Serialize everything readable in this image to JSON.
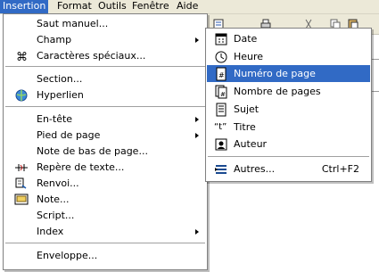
{
  "menubar": {
    "items": [
      {
        "label": "Insertion",
        "active": true
      },
      {
        "label": "Format"
      },
      {
        "label": "Outils"
      },
      {
        "label": "Fenêtre"
      },
      {
        "label": "Aide"
      }
    ]
  },
  "insert_menu": {
    "items": [
      {
        "label": "Saut manuel...",
        "submenu": false
      },
      {
        "label": "Champ",
        "submenu": true
      },
      {
        "label": "Caractères spéciaux...",
        "icon": "omega-symbol-icon"
      },
      {
        "label": "Section..."
      },
      {
        "label": "Hyperlien",
        "icon": "hyperlink-globe-icon"
      },
      {
        "label": "En-tête",
        "submenu": true
      },
      {
        "label": "Pied de page",
        "submenu": true
      },
      {
        "label": "Note de bas de page..."
      },
      {
        "label": "Repère de texte...",
        "icon": "bookmark-icon"
      },
      {
        "label": "Renvoi...",
        "icon": "cross-reference-icon"
      },
      {
        "label": "Note...",
        "icon": "note-icon"
      },
      {
        "label": "Script..."
      },
      {
        "label": "Index",
        "submenu": true
      },
      {
        "label": "Enveloppe..."
      }
    ]
  },
  "field_submenu": {
    "items": [
      {
        "label": "Date",
        "icon": "calendar-icon"
      },
      {
        "label": "Heure",
        "icon": "clock-icon"
      },
      {
        "label": "Numéro de page",
        "icon": "page-number-icon",
        "highlighted": true
      },
      {
        "label": "Nombre de pages",
        "icon": "page-count-icon"
      },
      {
        "label": "Sujet",
        "icon": "subject-icon"
      },
      {
        "label": "Titre",
        "icon_text": "“t”"
      },
      {
        "label": "Auteur",
        "icon": "author-icon"
      },
      {
        "label": "Autres...",
        "icon": "other-fields-icon",
        "shortcut": "Ctrl+F2"
      }
    ]
  },
  "colors": {
    "highlight": "#316ac5",
    "menubar_bg": "#ece9d8"
  }
}
